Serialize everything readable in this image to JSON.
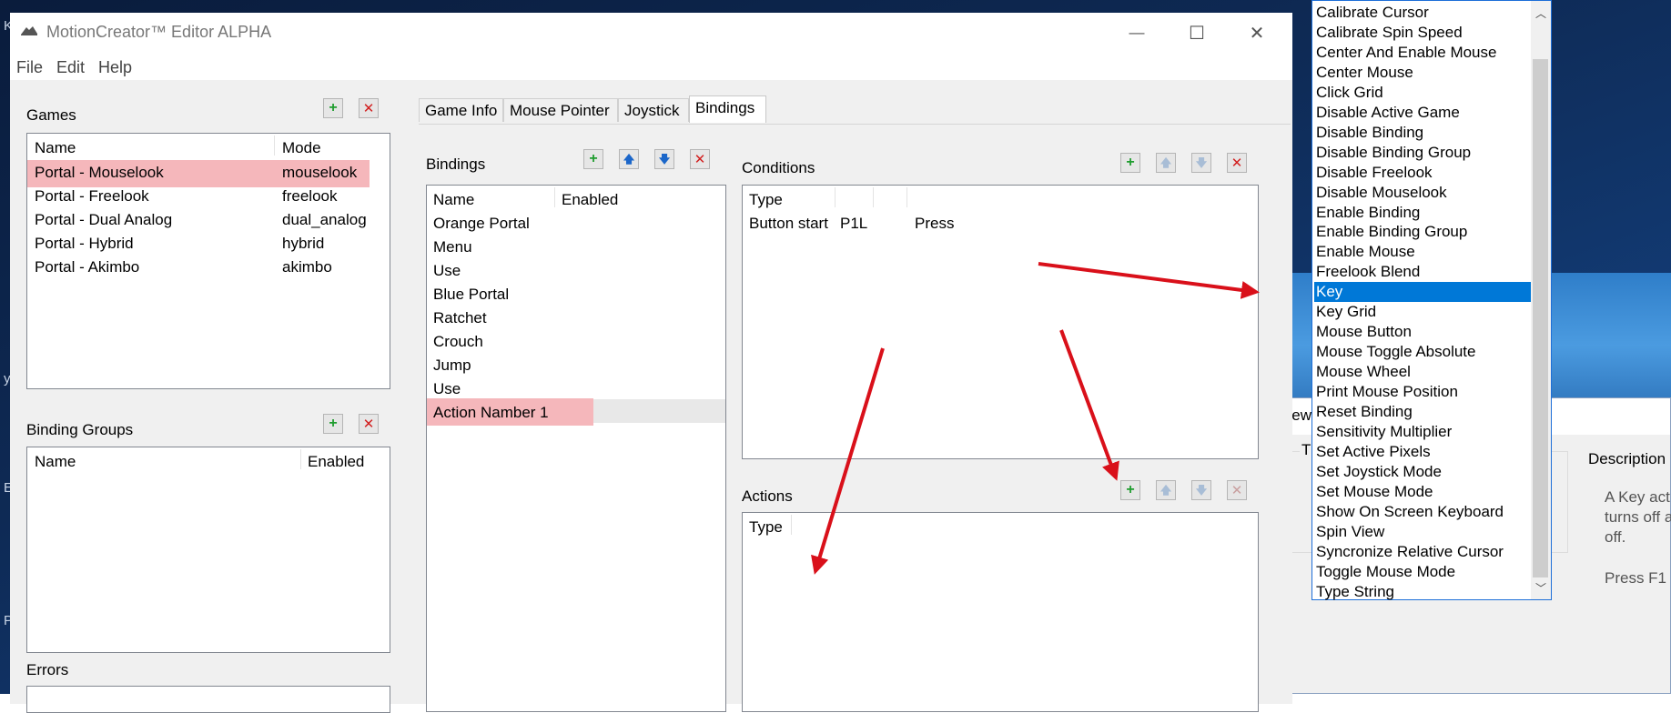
{
  "window": {
    "title": "MotionCreator™ Editor ALPHA",
    "controls": {
      "minimize": "—",
      "maximize": "☐",
      "close": "✕"
    }
  },
  "menu": [
    "File",
    "Edit",
    "Help"
  ],
  "games": {
    "title": "Games",
    "columns": [
      "Name",
      "Mode"
    ],
    "rows": [
      {
        "name": "Portal - Mouselook",
        "mode": "mouselook"
      },
      {
        "name": "Portal - Freelook",
        "mode": "freelook"
      },
      {
        "name": "Portal - Dual Analog",
        "mode": "dual_analog"
      },
      {
        "name": "Portal - Hybrid",
        "mode": "hybrid"
      },
      {
        "name": "Portal - Akimbo",
        "mode": "akimbo"
      }
    ]
  },
  "binding_groups": {
    "title": "Binding Groups",
    "columns": [
      "Name",
      "Enabled"
    ]
  },
  "errors": {
    "title": "Errors"
  },
  "tabs": [
    "Game Info",
    "Mouse Pointer",
    "Joystick",
    "Bindings"
  ],
  "bindings": {
    "title": "Bindings",
    "columns": [
      "Name",
      "Enabled"
    ],
    "rows": [
      "Orange Portal",
      "Menu",
      "Use",
      "Blue Portal",
      "Ratchet",
      "Crouch",
      "Jump",
      "Use",
      "Action Namber 1"
    ]
  },
  "conditions": {
    "title": "Conditions",
    "columns": [
      "Type"
    ],
    "row": {
      "type": "Button start",
      "key": "P1L",
      "event": "Press"
    }
  },
  "actions": {
    "title": "Actions",
    "columns": [
      "Type"
    ]
  },
  "action_types": {
    "items": [
      "Calibrate Cursor",
      "Calibrate Spin Speed",
      "Center And Enable Mouse",
      "Center Mouse",
      "Click Grid",
      "Disable Active Game",
      "Disable Binding",
      "Disable Binding Group",
      "Disable Freelook",
      "Disable Mouselook",
      "Enable Binding",
      "Enable Binding Group",
      "Enable Mouse",
      "Freelook Blend",
      "Key",
      "Key Grid",
      "Mouse Button",
      "Mouse Toggle Absolute",
      "Mouse Wheel",
      "Print Mouse Position",
      "Reset Binding",
      "Sensitivity Multiplier",
      "Set Active Pixels",
      "Set Joystick Mode",
      "Set Mouse Mode",
      "Show On Screen Keyboard",
      "Spin View",
      "Syncronize Relative Cursor",
      "Toggle Mouse Mode",
      "Type String"
    ],
    "selected": "Key"
  },
  "new_dialog": {
    "title_partial": "New",
    "group_letter": "T",
    "description_title": "Description",
    "description_lines": [
      "A Key act",
      "turns off a",
      "off."
    ],
    "hint": "Press F1"
  },
  "colors": {
    "selection": "#0078d7",
    "highlight": "#f5b7bb",
    "annotation_arrow": "#d9101a"
  }
}
